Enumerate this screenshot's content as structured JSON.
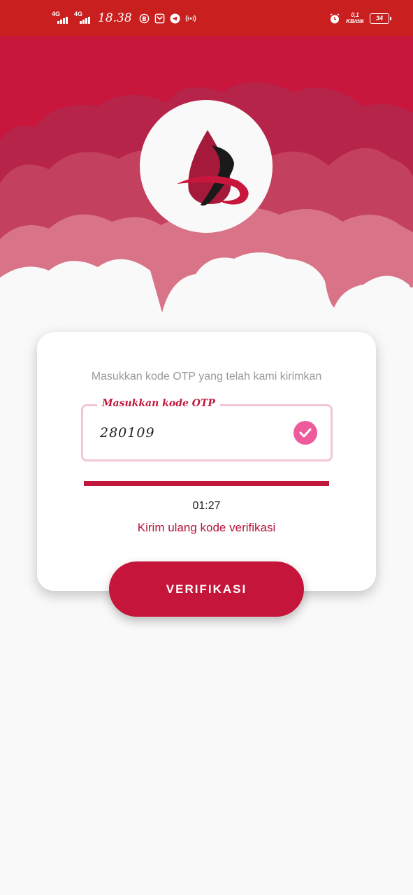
{
  "status_bar": {
    "network_1": "4G",
    "network_2": "4G",
    "time": "18.38",
    "speed_value": "0,1",
    "speed_unit": "KB/dtk",
    "battery": "34",
    "icons": [
      "b-icon",
      "mail-icon",
      "telegram-icon",
      "hotspot-icon",
      "alarm-icon"
    ]
  },
  "otp": {
    "prompt": "Masukkan kode OTP yang telah kami kirimkan",
    "field_label": "Masukkan kode OTP",
    "value": "280109",
    "valid_icon": "check-circle-icon"
  },
  "countdown": {
    "progress": 1.0,
    "time_left": "01:27"
  },
  "resend_label": "Kirim ulang kode verifikasi",
  "verify_button_label": "VERIFIKASI",
  "colors": {
    "status_bar": "#c91f1f",
    "brand": "#c6153b",
    "check": "#ed5b9b",
    "field_border": "#f2c6d2"
  }
}
